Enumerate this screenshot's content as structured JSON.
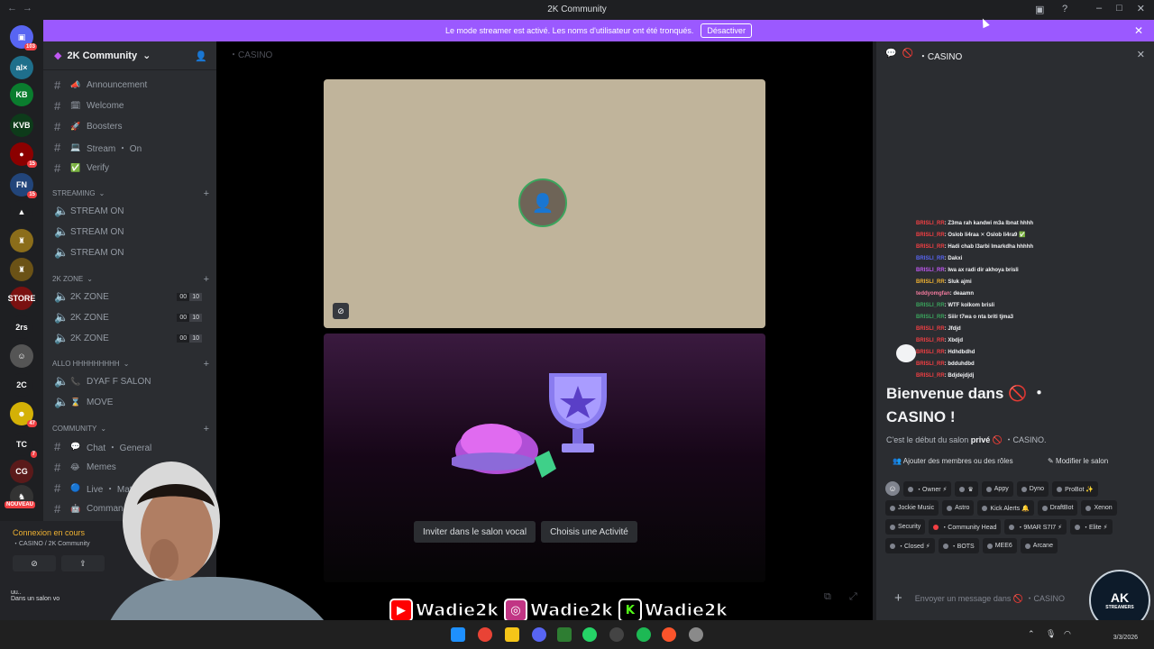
{
  "window": {
    "title": "2K Community",
    "back": "←",
    "forward": "→"
  },
  "banner": {
    "text": "Le mode streamer est activé. Les noms d'utilisateur ont été tronqués.",
    "button": "Désactiver",
    "close": "✕"
  },
  "guilds": [
    {
      "label": "▣",
      "badge": "103",
      "color": "#5865f2"
    },
    {
      "label": "al×",
      "color": "#1f6f8b"
    },
    {
      "label": "KB",
      "color": "#0a7d2e"
    },
    {
      "label": "KVB",
      "color": "#0d3b1a"
    },
    {
      "label": "●",
      "badge": "15",
      "color": "#8b0000"
    },
    {
      "label": "FN",
      "badge": "15",
      "color": "#22457a"
    },
    {
      "label": "▲",
      "color": "#1e1f22"
    },
    {
      "label": "♜",
      "color": "#8b6d1a"
    },
    {
      "label": "♜",
      "color": "#6b5216"
    },
    {
      "label": "STORE",
      "color": "#7a1111"
    },
    {
      "label": "2rs",
      "color": "#1e1f22"
    },
    {
      "label": "☺",
      "color": "#555"
    },
    {
      "label": "2C",
      "color": "#1e1f22"
    },
    {
      "label": "☻",
      "badge": "47",
      "color": "#d4b106"
    },
    {
      "label": "TC",
      "badge": "7",
      "color": "#1e1f22"
    },
    {
      "label": "CG",
      "color": "#5a1a1a"
    },
    {
      "label": "♞",
      "color": "#333"
    }
  ],
  "guild_new": "NOUVEAU",
  "server": {
    "name": "2K Community"
  },
  "channels": [
    {
      "type": "text",
      "emoji": "📣",
      "name": "Announcement"
    },
    {
      "type": "text",
      "emoji": "🗓",
      "name": "Welcome"
    },
    {
      "type": "text",
      "emoji": "🚀",
      "name": "Boosters"
    },
    {
      "type": "text",
      "emoji": "💻",
      "name": "Stream ・ On"
    },
    {
      "type": "text",
      "emoji": "✅",
      "name": "Verify"
    }
  ],
  "cat_streaming": "STREAMING",
  "streaming_channels": [
    "STREAM ON",
    "STREAM ON",
    "STREAM ON"
  ],
  "cat_2kzone": "2K ZONE",
  "zone_channels": [
    {
      "name": "2K ZONE",
      "count": "00",
      "limit": "10"
    },
    {
      "name": "2K ZONE",
      "count": "00",
      "limit": "10"
    },
    {
      "name": "2K ZONE",
      "count": "00",
      "limit": "10"
    }
  ],
  "cat_allo": "ALLO HHHHHHHHH",
  "allo_channels": [
    {
      "emoji": "📞",
      "name": "DYAF F SALON"
    },
    {
      "emoji": "⌛",
      "name": "MOVE"
    }
  ],
  "cat_community": "COMMUNITY",
  "community_channels": [
    {
      "emoji": "💬",
      "name": "Chat ・ General"
    },
    {
      "emoji": "😂",
      "name": "Memes"
    },
    {
      "emoji": "🔵",
      "name": "Live ・ Mat"
    },
    {
      "emoji": "🤖",
      "name": "Comman"
    }
  ],
  "voice": {
    "status": "Connexion en cours",
    "sub": "・CASINO / 2K Community"
  },
  "user": {
    "name": "uu..",
    "status": "Dans un salon vo"
  },
  "main": {
    "header": "・CASINO"
  },
  "call": {
    "invite": "Inviter dans le salon vocal",
    "activity": "Choisis une Activité"
  },
  "chat": {
    "header": "・CASINO",
    "feed": [
      {
        "user": "BRISLI_RR",
        "msg": ": Z3ma rah kandwi m3a lbnat hhhh",
        "color": "#f23f43"
      },
      {
        "user": "BRISLI_RR",
        "msg": ": Oslob li4raa ✕ Oslob li4ra9 ✅",
        "color": "#f23f43"
      },
      {
        "user": "BRISLI_RR",
        "msg": ": Hadi chab l3arbi lmarkdha hhhhh",
        "color": "#f23f43"
      },
      {
        "user": "BRISLI_RR",
        "msg": ": Dakxi",
        "color": "#5865f2"
      },
      {
        "user": "BRISLI_RR",
        "msg": ": Iwa ax radi dir akhoya brisli",
        "color": "#c058f2"
      },
      {
        "user": "BRISLI_RR",
        "msg": ": Sluk ajmi",
        "color": "#f0b232"
      },
      {
        "user": "teddyomgfan",
        "msg": ": deaamn",
        "color": "#f27a9e"
      },
      {
        "user": "BRISLI_RR",
        "msg": ": WTF kolkom brisli",
        "color": "#3ba55d"
      },
      {
        "user": "BRISLI_RR",
        "msg": ": Siiir t7wa o nta briti tjma3",
        "color": "#3ba55d"
      },
      {
        "user": "BRISLI_RR",
        "msg": ": Jfdjd",
        "color": "#f23f43"
      },
      {
        "user": "BRISLI_RR",
        "msg": ": Xbdjd",
        "color": "#f23f43"
      },
      {
        "user": "BRISLI_RR",
        "msg": ": Hdhdbdhd",
        "color": "#f23f43"
      },
      {
        "user": "BRISLI_RR",
        "msg": ": bdduhdbd",
        "color": "#f23f43"
      },
      {
        "user": "BRISLI_RR",
        "msg": ": Bdjdejdjdj",
        "color": "#f23f43"
      }
    ],
    "welcome": "Bienvenue dans 🚫 ・ CASINO !",
    "sub_pre": "C'est le début du salon ",
    "sub_bold": "privé",
    "sub_post": " 🚫 ・CASINO.",
    "add_members": "Ajouter des membres ou des rôles",
    "edit": "Modifier le salon",
    "roles": [
      "・Owner ⚡",
      "♛",
      "Appy",
      "Dyno",
      "ProBot ✨",
      "Jockie Music",
      "Astro",
      "Kick Alerts 🔔",
      "DraftBot",
      "Xenon",
      "Security",
      "・Community Head",
      "・9MAR S7I7 ⚡",
      "・Elite ⚡",
      "・Closed ⚡",
      "・BOTS",
      "MEE6",
      "Arcane"
    ],
    "input_placeholder": "Envoyer un message dans 🚫 ・CASINO"
  },
  "overlay": {
    "youtube": "Wadie2k",
    "instagram": "Wadie2k",
    "kick": "Wadie2k"
  },
  "logo": {
    "text": "AK",
    "sub": "STREAMERS"
  },
  "taskbar": {
    "date": "3/3/2026"
  },
  "colors": {
    "accent": "#9b59ff",
    "sidebar": "#2b2d31",
    "bg": "#1e1f22"
  }
}
